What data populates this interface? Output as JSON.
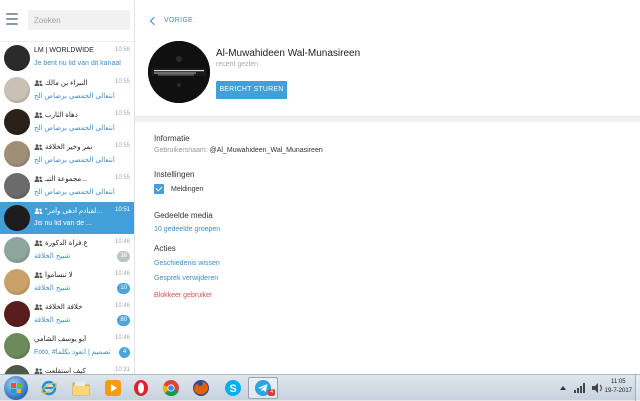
{
  "search": {
    "placeholder": "Zoeken"
  },
  "chats": [
    {
      "title": "LM | WORLDWIDE",
      "time": "10:58",
      "preview": "Je bent nu lid van dit kanaal",
      "badge": "",
      "avatar": "#2b2b2b",
      "group": false,
      "active": false
    },
    {
      "title": "النبراء بن مالك",
      "time": "10:55",
      "preview": "أنتعالى الحمصي برضاص الح",
      "badge": "",
      "avatar": "#c9c2b4",
      "group": true,
      "active": false
    },
    {
      "title": "دهاة الثارب",
      "time": "10:55",
      "preview": "أنتعالى الحمصي برضاص الح",
      "badge": "",
      "avatar": "#2a2218",
      "group": true,
      "active": false
    },
    {
      "title": "نمر وخير الخلافة",
      "time": "10:55",
      "preview": "أنتعالى الحمصي برضاص الح",
      "badge": "",
      "avatar": "#a08f76",
      "group": true,
      "active": false
    },
    {
      "title": "مجموعة التبـ...",
      "time": "10:55",
      "preview": "أنتعالى الحمصي برضاص الح",
      "badge": "",
      "avatar": "#6b6b6b",
      "group": true,
      "active": false
    },
    {
      "title": "\"والقبادم أدهى وأمر\"",
      "time": "10:51",
      "preview": "Jis nu lid van de ...",
      "badge": "",
      "avatar": "#1d1d1d",
      "group": true,
      "active": true
    },
    {
      "title": "ع.فراة الدكورة",
      "time": "10:46",
      "preview": "شبيح الخلافة",
      "badge": "38",
      "avatar": "#8fa69c",
      "group": true,
      "active": false
    },
    {
      "title": "لا تنسأموا",
      "time": "10:46",
      "preview": "شبيح الخلافة",
      "badge": "10",
      "avatar": "#c9a26a",
      "group": true,
      "active": false
    },
    {
      "title": "خلافة الخلافة",
      "time": "10:46",
      "preview": "شبيح الخلافة",
      "badge": "80",
      "avatar": "#5a1d1d",
      "group": true,
      "active": false
    },
    {
      "title": "أبو يوسف الشامي",
      "time": "10:46",
      "preview": "Foto, #تصميم | أتعود بكلما",
      "badge": "4",
      "avatar": "#6d8a5a",
      "group": false,
      "active": false
    },
    {
      "title": "كيف استقلعت",
      "time": "10:31",
      "preview": "",
      "badge": "",
      "avatar": "#4a5a44",
      "group": true,
      "active": false
    }
  ],
  "profile": {
    "back_label": "VORIGE",
    "name": "Al-Muwahideen Wal-Munasireen",
    "status": "recent gezien",
    "send_button": "BERICHT STUREN"
  },
  "info": {
    "title": "Informatie",
    "username_label": "Gebruikersnaam:",
    "username_value": "@Al_Muwahideen_Wal_Munasireen"
  },
  "settings": {
    "title": "Instellingen",
    "notifications_label": "Meldingen",
    "notifications_checked": true
  },
  "media": {
    "title": "Gedeelde media",
    "groups_link": "10 gedeelde groepen"
  },
  "actions": {
    "title": "Acties",
    "clear_history": "Geschiedenis wissen",
    "delete_chat": "Gesprek verwijderen",
    "block_user": "Blokkeer gebruiker"
  },
  "taskbar": {
    "time": "11:05",
    "date": "19-7-2017",
    "apps": [
      "internet-explorer",
      "file-explorer",
      "media-player",
      "opera",
      "chrome",
      "firefox",
      "skype",
      "telegram"
    ],
    "telegram_badge": "4"
  },
  "colors": {
    "accent": "#419fd9",
    "link": "#3c8ecb",
    "danger": "#d9534f"
  }
}
